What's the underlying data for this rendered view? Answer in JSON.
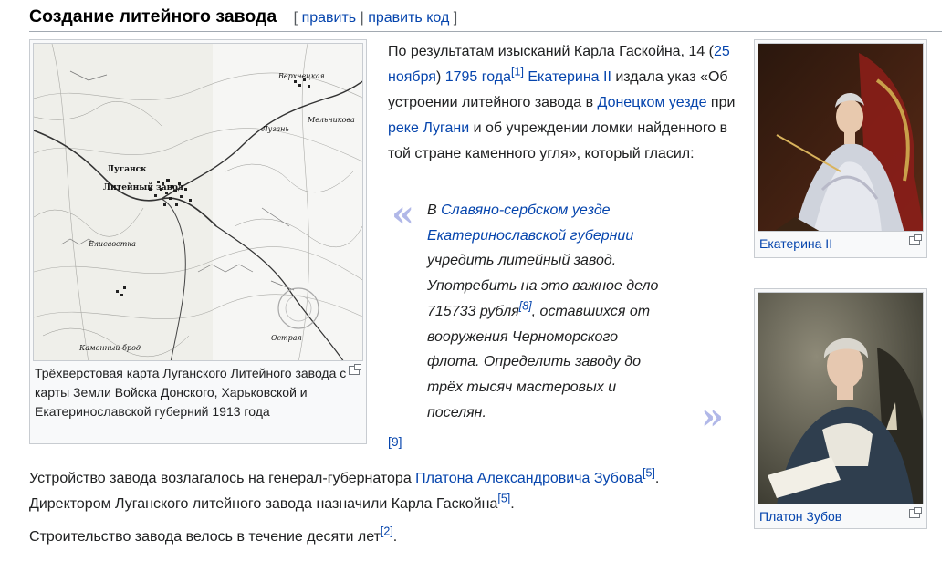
{
  "heading": {
    "title": "Создание литейного завода",
    "bracket_open": "[",
    "edit": "править",
    "sep": "|",
    "edit_code": "править код",
    "bracket_close": "]"
  },
  "map_figure": {
    "caption": "Трёхверстовая карта Луганского Литейного завода с карты Земли Войска Донского, Харьковской и Екатеринославской губерний 1913 года",
    "icon": "magnify-icon"
  },
  "catherine_figure": {
    "caption": "Екатерина II",
    "icon": "magnify-icon"
  },
  "zubov_figure": {
    "caption": "Платон Зубов",
    "icon": "magnify-icon"
  },
  "intro": {
    "t1": "По результатам изысканий Карла Гаскойна, 14 (",
    "l1": "25 ноября",
    "t2": ") ",
    "l2": "1795 года",
    "r1": "[1]",
    "t3": " ",
    "l3": "Екатерина II",
    "t4": " издала указ «Об устроении литейного завода в ",
    "l4": "Донецком уезде",
    "t5": " при ",
    "l5": "реке Лугани",
    "t6": " и об учреждении ломки найденного в той стране каменного угля», который гласил:"
  },
  "quote": {
    "open_mark": "«",
    "close_mark": "»",
    "t1": "В ",
    "l1": "Славяно-сербском уезде",
    "t2": " ",
    "l2": "Екатеринославской губернии",
    "t3": " учредить литейный завод. Употребить на это важное дело 715733 рубля",
    "r1": "[8]",
    "t4": ", оставшихся от вооружения Черноморского флота. Определить заводу до трёх тысяч мастеровых и поселян.",
    "ref": "[9]"
  },
  "para1": {
    "t1": "Устройство завода возлагалось на генерал-губернатора ",
    "l1": "Платона Александровича Зубова",
    "r1": "[5]",
    "t2": ".",
    "t3": "Директором Луганского литейного завода назначили Карла Гаскойна",
    "r2": "[5]",
    "t4": "."
  },
  "para3": {
    "t1": "Строительство завода велось в течение десяти лет",
    "r1": "[2]",
    "t2": "."
  },
  "map_labels": {
    "a": "Верхнецкая",
    "b": "Луганск",
    "c": "Литейный завод",
    "d": "Елисаветка",
    "e": "Лугань",
    "f": "Острая",
    "g": "Мельникова",
    "h": "Каменный брод"
  }
}
